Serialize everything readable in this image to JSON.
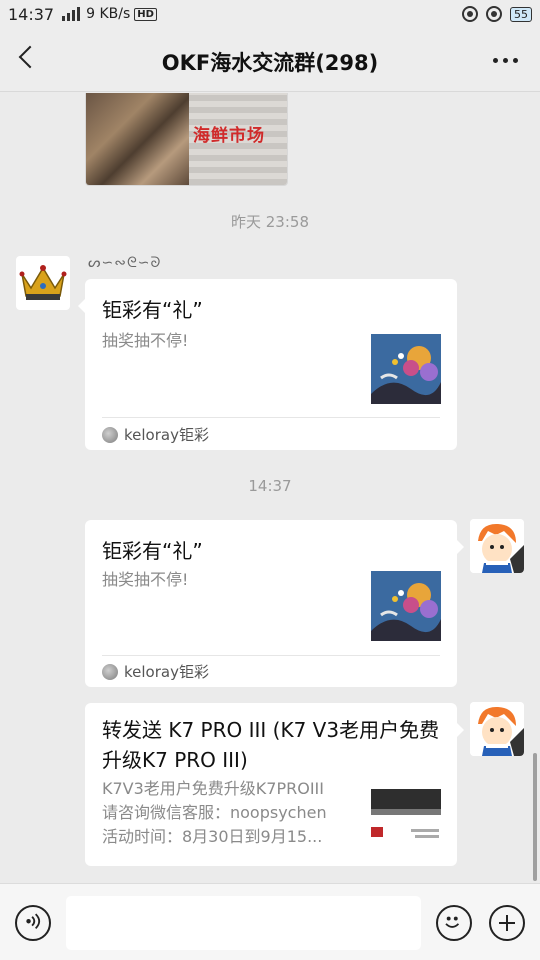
{
  "status_bar": {
    "time": "14:37",
    "network_type": "4G",
    "speed": "9 KB/s",
    "hd": "HD",
    "battery": "55"
  },
  "header": {
    "title": "OKF海水交流群(298)"
  },
  "partial_image": {
    "overlay_text": "海鲜市场"
  },
  "messages": {
    "timestamp_1": "昨天 23:58",
    "timestamp_2": "14:37",
    "card1": {
      "title": "钜彩有“礼”",
      "desc": "抽奖抽不停!",
      "source": "keloray钜彩"
    },
    "card2": {
      "title": "钜彩有“礼”",
      "desc": "抽奖抽不停!",
      "source": "keloray钜彩"
    },
    "card3": {
      "title": "转发送 K7 PRO III (K7 V3老用户免费升级K7 PRO III)",
      "desc_lines": [
        "K7V3老用户免费升级K7PROIII",
        "请咨询微信客服：noopsychen",
        "活动时间：8月30日到9月15..."
      ]
    }
  },
  "colors": {
    "background": "#ebebeb",
    "card": "#ffffff",
    "timestamp": "#9a9a9a"
  }
}
